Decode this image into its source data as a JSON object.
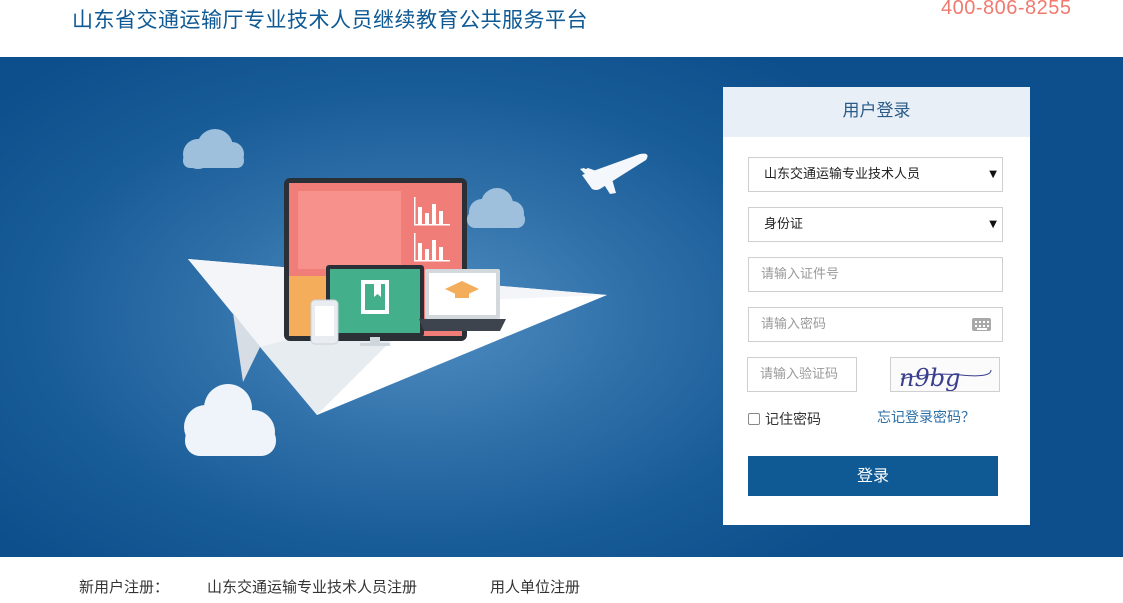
{
  "header": {
    "site_title": "山东省交通运输厅专业技术人员继续教育公共服务平台",
    "hotline": "400-806-8255"
  },
  "login": {
    "title": "用户登录",
    "user_type_selected": "山东交通运输专业技术人员",
    "id_type_selected": "身份证",
    "id_placeholder": "请输入证件号",
    "password_placeholder": "请输入密码",
    "captcha_placeholder": "请输入验证码",
    "captcha_text": "n9bg",
    "remember_label": "记住密码",
    "forgot_label": "忘记登录密码？",
    "submit_label": "登录"
  },
  "footer": {
    "register_label": "新用户注册：",
    "links": [
      "山东交通运输专业技术人员注册",
      "用人单位注册"
    ]
  },
  "colors": {
    "brand_blue": "#0f5a94",
    "hotline_red": "#f07a70",
    "banner_blue": "#175b97"
  },
  "icons": [
    "cloud-icon",
    "airplane-icon",
    "paper-plane-icon",
    "monitor-icon",
    "tablet-icon",
    "laptop-icon",
    "keyboard-icon",
    "checkbox-icon",
    "dropdown-arrow-icon"
  ]
}
